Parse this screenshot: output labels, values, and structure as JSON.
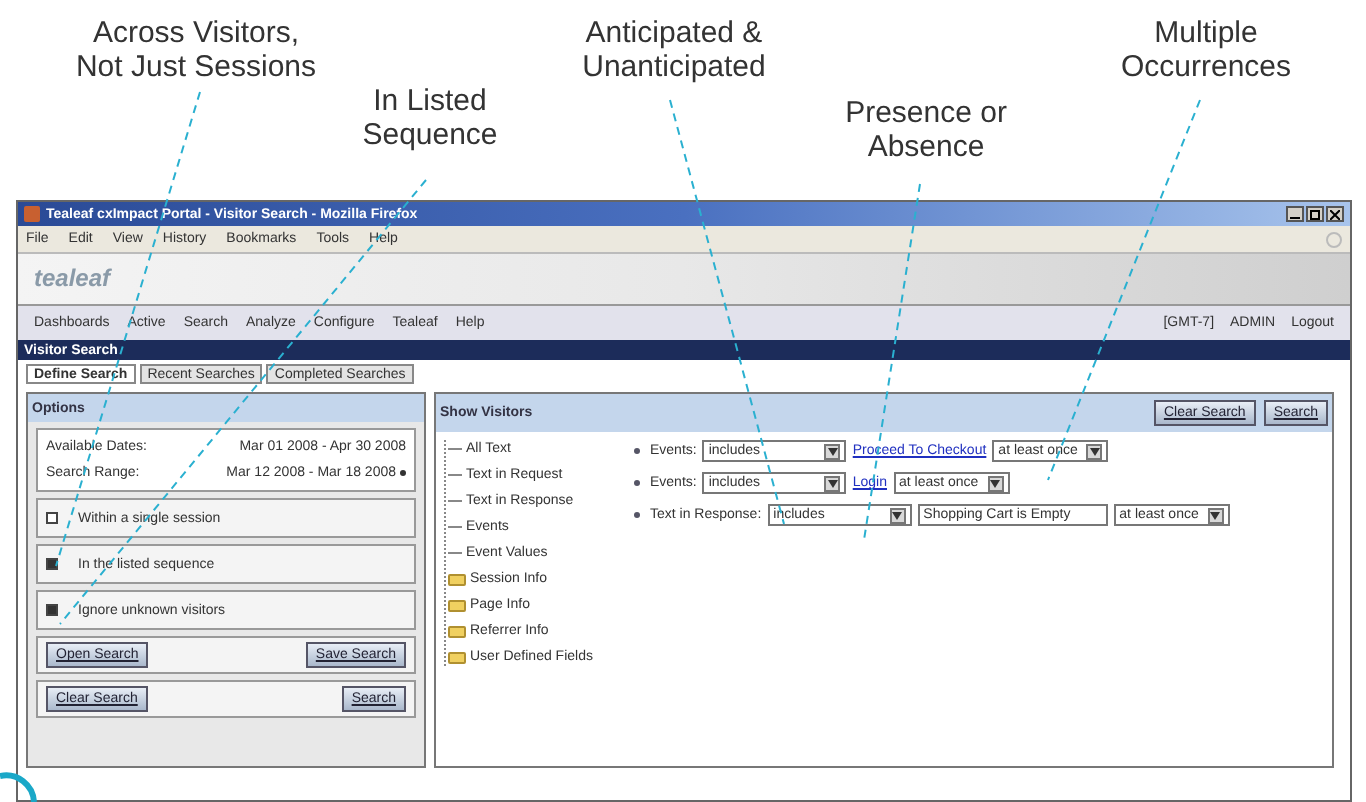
{
  "callouts": [
    {
      "text": "Across Visitors,\nNot Just Sessions"
    },
    {
      "text": "In Listed\nSequence"
    },
    {
      "text": "Anticipated &\nUnanticipated"
    },
    {
      "text": "Presence or\nAbsence"
    },
    {
      "text": "Multiple\nOccurrences"
    }
  ],
  "window": {
    "title": "Tealeaf cxImpact Portal - Visitor Search - Mozilla Firefox"
  },
  "menu": [
    "File",
    "Edit",
    "View",
    "History",
    "Bookmarks",
    "Tools",
    "Help"
  ],
  "logo": "tealeaf",
  "nav": [
    "Dashboards",
    "Active",
    "Search",
    "Analyze",
    "Configure",
    "Tealeaf",
    "Help"
  ],
  "nav_right": [
    "[GMT-7]",
    "ADMIN",
    "Logout"
  ],
  "page_title": "Visitor Search",
  "tabs": [
    {
      "label": "Define Search",
      "selected": true
    },
    {
      "label": "Recent Searches",
      "selected": false
    },
    {
      "label": "Completed Searches",
      "selected": false
    }
  ],
  "options": {
    "title": "Options",
    "dates": [
      {
        "label": "Available Dates:",
        "value": "Mar 01 2008 - Apr 30 2008"
      },
      {
        "label": "Search Range:",
        "value": "Mar 12 2008 - Mar 18 2008"
      }
    ],
    "checkboxes": [
      {
        "label": "Within a single session",
        "checked": false
      },
      {
        "label": "In the listed sequence",
        "checked": true
      },
      {
        "label": "Ignore unknown visitors",
        "checked": true
      }
    ],
    "button_rows": [
      [
        "Open Search",
        "Save Search"
      ],
      [
        "Clear Search",
        "Search"
      ]
    ]
  },
  "show_visitors": {
    "title": "Show Visitors",
    "buttons": [
      "Clear Search",
      "Search"
    ],
    "tree": [
      {
        "label": "All Text",
        "kind": "leaf"
      },
      {
        "label": "Text in Request",
        "kind": "leaf"
      },
      {
        "label": "Text in Response",
        "kind": "leaf"
      },
      {
        "label": "Events",
        "kind": "leaf"
      },
      {
        "label": "Event Values",
        "kind": "leaf"
      },
      {
        "label": "Session Info",
        "kind": "folder"
      },
      {
        "label": "Page Info",
        "kind": "folder"
      },
      {
        "label": "Referrer Info",
        "kind": "folder"
      },
      {
        "label": "User Defined Fields",
        "kind": "folder"
      }
    ],
    "criteria": [
      {
        "label": "Events:",
        "operator": "includes",
        "value": "Proceed To Checkout",
        "kind": "link",
        "count": "at least once"
      },
      {
        "label": "Events:",
        "operator": "includes",
        "value": "Login",
        "kind": "link",
        "count": "at least once"
      },
      {
        "label": "Text in Response:",
        "operator": "includes",
        "value": "Shopping Cart is Empty",
        "kind": "text",
        "count": "at least once"
      }
    ]
  }
}
